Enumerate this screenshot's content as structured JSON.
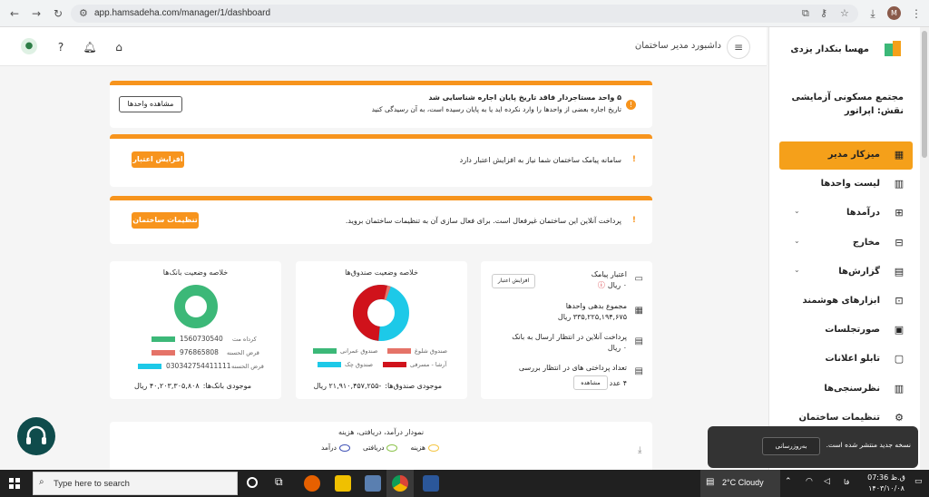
{
  "browser": {
    "url": "app.hamsadeha.com/manager/1/dashboard",
    "profile_initial": "M"
  },
  "header": {
    "title": "داشبورد مدیر ساختمان"
  },
  "sidebar": {
    "user_name": "مهسا بنکدار یزدی",
    "complex_name": "مجتمع مسکونی آزمایشی",
    "role": "نقش: اپراتور",
    "items": [
      {
        "label": "میزکار مدیر",
        "icon": "dashboard-icon",
        "active": true,
        "expandable": false
      },
      {
        "label": "لیست واحدها",
        "icon": "building-icon",
        "active": false,
        "expandable": false
      },
      {
        "label": "درآمدها",
        "icon": "income-icon",
        "active": false,
        "expandable": true
      },
      {
        "label": "مخارج",
        "icon": "expense-icon",
        "active": false,
        "expandable": true
      },
      {
        "label": "گزارش‌ها",
        "icon": "report-icon",
        "active": false,
        "expandable": true
      },
      {
        "label": "ابزارهای هوشمند",
        "icon": "robot-icon",
        "active": false,
        "expandable": false
      },
      {
        "label": "صورتجلسات",
        "icon": "minutes-icon",
        "active": false,
        "expandable": false
      },
      {
        "label": "تابلو اعلانات",
        "icon": "board-icon",
        "active": false,
        "expandable": false
      },
      {
        "label": "نظرسنجی‌ها",
        "icon": "poll-icon",
        "active": false,
        "expandable": false
      },
      {
        "label": "تنظیمات ساختمان",
        "icon": "settings-icon",
        "active": false,
        "expandable": false
      }
    ]
  },
  "alerts": {
    "lease": {
      "title": "۵ واحد مستاجردار فاقد تاریخ پایان اجاره شناسایی شد",
      "body": "تاریخ اجاره بعضی از واحدها را وارد نکرده اید یا به پایان رسیده است، به آن رسیدگی کنید",
      "button": "مشاهده واحدها"
    },
    "sms": {
      "text": "سامانه پیامک ساختمان شما نیاز به افزایش اعتبار دارد",
      "button": "افزایش اعتبار"
    },
    "payment": {
      "text": "پرداخت آنلاین این ساختمان غیرفعال است. برای فعال سازی آن به تنظیمات ساختمان بروید.",
      "button": "تنظیمات ساختمان"
    }
  },
  "info_card": {
    "sms_credit_label": "اعتبار پیامک",
    "sms_credit_value": "۰ ریال",
    "sms_button": "افزایش اعتبار",
    "debt_label": "مجموع بدهی واحدها",
    "debt_value": "۳۳۵,۲۲۵,۱۹۴,۶۷۵ ریال",
    "online_label": "پرداخت آنلاین در انتظار ارسال به بانک",
    "online_value": "۰ ریال",
    "review_label": "تعداد پرداختی های در انتظار بررسی",
    "review_value": "۴ عدد",
    "review_button": "مشاهده"
  },
  "funds_card": {
    "title": "خلاصه وضعیت صندوق‌ها",
    "balance_label": "موجودی صندوق‌ها:",
    "balance_value": "-۲۱,۹۱۰,۴۵۷,۲۵۵ ریال",
    "legend": [
      {
        "label": "صندوق شلوغ",
        "color": "#e57368"
      },
      {
        "label": "صندوق عمرانی",
        "color": "#3cb878"
      },
      {
        "label": "آرشا - مسرفی",
        "color": "#d0121b"
      },
      {
        "label": "صندوق چک",
        "color": "#1dc9e8"
      }
    ]
  },
  "bank_card": {
    "title": "خلاصه وضعیت بانک‌ها",
    "balance_label": "موجودی بانک‌ها:",
    "balance_value": "۴۰,۲۰۳,۳۰۵,۸۰۸ ریال",
    "legend": [
      {
        "label": "کرداه مت",
        "number": "1560730540",
        "color": "#3cb878"
      },
      {
        "label": "قرض الحسنه",
        "number": "976865808",
        "color": "#e57368"
      },
      {
        "label": "قرض الحسنه",
        "number": "030342754411111",
        "color": "#1dc9e8"
      }
    ]
  },
  "income_chart": {
    "title": "نمودار درآمد، دریافتی، هزینه",
    "legend": [
      {
        "label": "هزینه",
        "color": "#f5c542"
      },
      {
        "label": "دریافتی",
        "color": "#8bc34a"
      },
      {
        "label": "درآمد",
        "color": "#3f51b5"
      }
    ]
  },
  "toast": {
    "text": "نسخه جدید منتشر شده است.",
    "button": "به‌روزرسانی"
  },
  "taskbar": {
    "search_placeholder": "Type here to search",
    "weather": "2°C  Cloudy",
    "time": "ق.ظ 07:36",
    "date": "۱۴۰۳/۱۰/۰۸",
    "lang": "فا"
  }
}
